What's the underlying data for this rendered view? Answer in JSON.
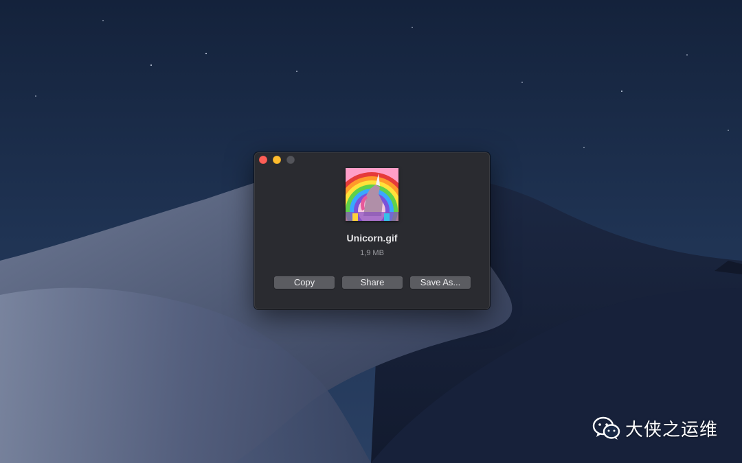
{
  "dialog": {
    "file_name": "Unicorn.gif",
    "file_size": "1,9 MB",
    "buttons": {
      "copy": "Copy",
      "share": "Share",
      "save_as": "Save As..."
    }
  },
  "watermark": {
    "text": "大侠之运维"
  },
  "colors": {
    "window_background": "#2a2b30",
    "close": "#fe5f57",
    "minimize": "#febc2e",
    "zoom_inactive": "#53545a",
    "button": "#5b5c61"
  },
  "icons": [
    "close-icon",
    "minimize-icon",
    "zoom-icon",
    "wechat-icon"
  ]
}
